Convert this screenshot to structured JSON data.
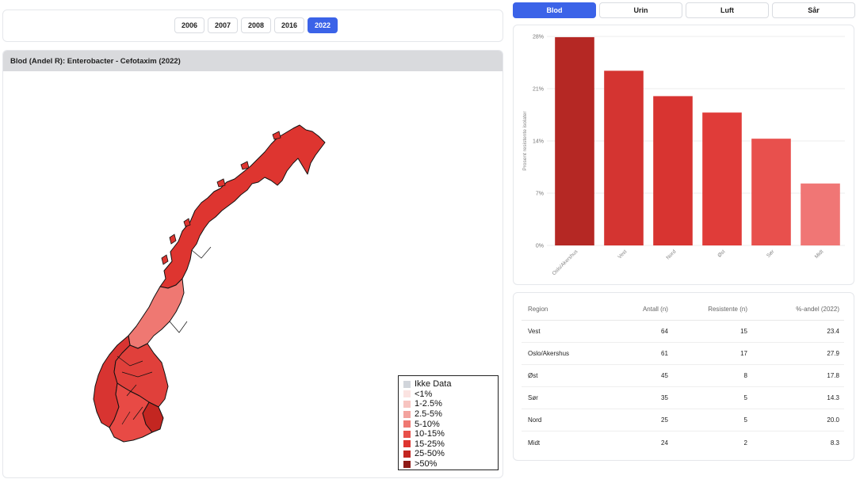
{
  "years": [
    {
      "label": "2006",
      "active": false
    },
    {
      "label": "2007",
      "active": false
    },
    {
      "label": "2008",
      "active": false
    },
    {
      "label": "2016",
      "active": false
    },
    {
      "label": "2022",
      "active": true
    }
  ],
  "map": {
    "title": "Blod (Andel R): Enterobacter - Cefotaxim (2022)",
    "legend": [
      {
        "label": "Ikke Data",
        "color": "#d1d5db"
      },
      {
        "label": "<1%",
        "color": "#fbe3e1"
      },
      {
        "label": "1-2.5%",
        "color": "#f7c4c0"
      },
      {
        "label": "2.5-5%",
        "color": "#f3a39e"
      },
      {
        "label": "5-10%",
        "color": "#ef7872"
      },
      {
        "label": "10-15%",
        "color": "#e8504a"
      },
      {
        "label": "15-25%",
        "color": "#de3530"
      },
      {
        "label": "25-50%",
        "color": "#c32621"
      },
      {
        "label": ">50%",
        "color": "#8e1a16"
      }
    ],
    "region_colors": {
      "nord": "#de3530",
      "midt": "#ef7872",
      "vest": "#d83431",
      "ost": "#e0403b",
      "oslo": "#c32621",
      "sor": "#e84a45"
    }
  },
  "tabs": [
    {
      "label": "Blod",
      "active": true
    },
    {
      "label": "Urin",
      "active": false
    },
    {
      "label": "Luft",
      "active": false
    },
    {
      "label": "Sår",
      "active": false
    }
  ],
  "chart_data": {
    "type": "bar",
    "categories": [
      "Oslo/Akershus",
      "Vest",
      "Nord",
      "Øst",
      "Sør",
      "Midt"
    ],
    "values": [
      27.9,
      23.4,
      20.0,
      17.8,
      14.3,
      8.3
    ],
    "colors": [
      "#b52824",
      "#d43431",
      "#d83431",
      "#e03c39",
      "#e8504d",
      "#f07675"
    ],
    "ylabel": "Prosent resistente isolater",
    "yticks": [
      "0%",
      "7%",
      "14%",
      "21%",
      "28%"
    ],
    "ylim": [
      0,
      28
    ]
  },
  "table": {
    "headers": [
      "Region",
      "Antall (n)",
      "Resistente (n)",
      "%-andel (2022)"
    ],
    "rows": [
      [
        "Vest",
        "64",
        "15",
        "23.4"
      ],
      [
        "Oslo/Akershus",
        "61",
        "17",
        "27.9"
      ],
      [
        "Øst",
        "45",
        "8",
        "17.8"
      ],
      [
        "Sør",
        "35",
        "5",
        "14.3"
      ],
      [
        "Nord",
        "25",
        "5",
        "20.0"
      ],
      [
        "Midt",
        "24",
        "2",
        "8.3"
      ]
    ]
  }
}
